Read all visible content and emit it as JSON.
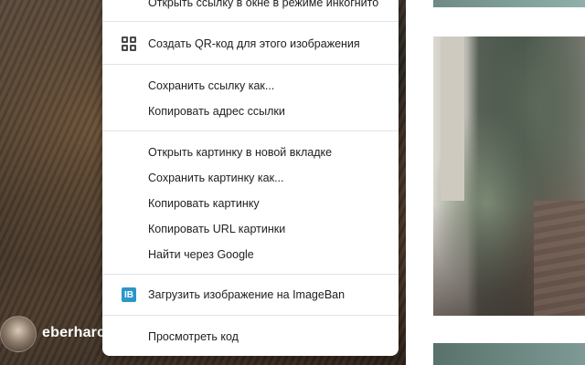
{
  "background": {
    "username": "eberharc"
  },
  "menu": {
    "items": [
      {
        "id": "incognito",
        "label": "Открыть ссылку в окне в режиме инкогнито"
      },
      {
        "id": "qr",
        "label": "Создать QR-код для этого изображения",
        "icon": "qr-code-icon"
      },
      {
        "id": "save-link",
        "label": "Сохранить ссылку как..."
      },
      {
        "id": "copy-link",
        "label": "Копировать адрес ссылки"
      },
      {
        "id": "open-image",
        "label": "Открыть картинку в новой вкладке"
      },
      {
        "id": "save-image",
        "label": "Сохранить картинку как..."
      },
      {
        "id": "copy-image",
        "label": "Копировать картинку"
      },
      {
        "id": "copy-image-url",
        "label": "Копировать URL картинки"
      },
      {
        "id": "search-google",
        "label": "Найти через Google"
      },
      {
        "id": "imageban",
        "label": "Загрузить изображение на ImageBan",
        "icon": "imageban-icon",
        "icon_text": "IB"
      },
      {
        "id": "inspect",
        "label": "Просмотреть код"
      }
    ]
  },
  "colors": {
    "menu_bg": "#ffffff",
    "separator": "#e3e3e3",
    "imageban_accent": "#2b96c8"
  }
}
